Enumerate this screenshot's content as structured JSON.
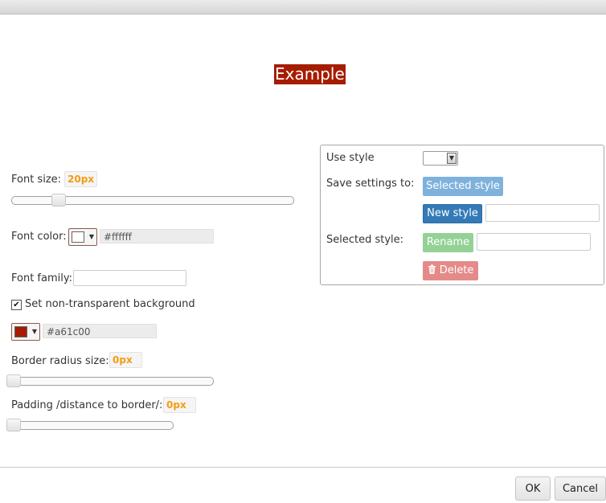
{
  "preview": {
    "text": "Example",
    "text_color": "#ffffff",
    "background": "#a61c00"
  },
  "font_size": {
    "label": "Font size:",
    "value": "20px",
    "slider_fraction": 0.16
  },
  "font_color": {
    "label": "Font color:",
    "swatch": "#ffffff",
    "hex": "#ffffff"
  },
  "font_family": {
    "label": "Font family:",
    "value": ""
  },
  "background": {
    "checkbox_label": "Set non-transparent background",
    "checked": true,
    "swatch": "#a61c00",
    "hex": "#a61c00"
  },
  "border_radius": {
    "label": "Border radius size:",
    "value": "0px",
    "slider_fraction": 0
  },
  "padding": {
    "label": "Padding /distance to border/:",
    "value": "0px",
    "slider_fraction": 0
  },
  "style_panel": {
    "use_style_label": "Use style",
    "save_label": "Save settings to:",
    "selected_style_button": "Selected style",
    "new_style_button": "New style",
    "new_style_value": "",
    "selected_style_label": "Selected style:",
    "rename_button": "Rename",
    "rename_value": "",
    "delete_button": "Delete"
  },
  "footer": {
    "ok": "OK",
    "cancel": "Cancel"
  }
}
